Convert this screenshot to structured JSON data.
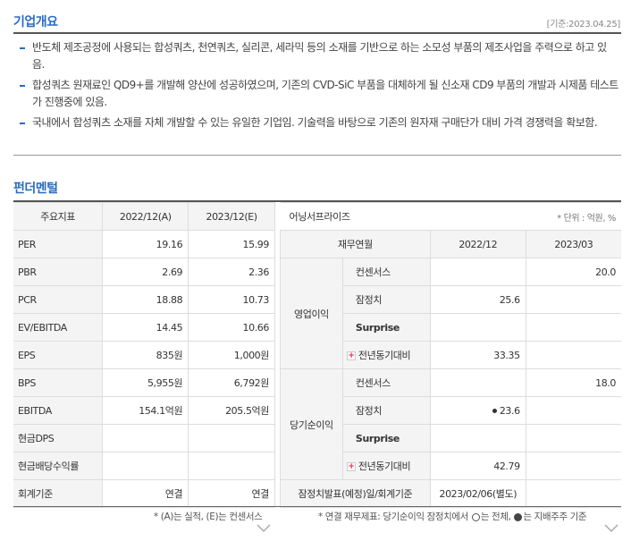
{
  "overview": {
    "title": "기업개요",
    "date": "[기준:2023.04.25]",
    "bullets": [
      "반도체 제조공정에 사용되는 합성쿼츠, 천연쿼츠, 실리콘, 세라믹 등의 소재를 기반으로 하는 소모성 부품의 제조사업을 주력으로 하고 있음.",
      "합성쿼츠 원재료인 QD9+를 개발해 양산에 성공하였으며, 기존의 CVD-SiC 부품을 대체하게 될 신소재 CD9 부품의 개발과 시제품 테스트가 진행중에 있음.",
      "국내에서 합성쿼츠 소재를 자체 개발할 수 있는 유일한 기업임. 기술력을 바탕으로 기존의 원자재 구매단가 대비 가격 경쟁력을 확보함."
    ]
  },
  "fundamental": {
    "title": "펀더멘털",
    "headers": [
      "주요지표",
      "2022/12(A)",
      "2023/12(E)"
    ],
    "rows": [
      {
        "label": "PER",
        "a": "19.16",
        "e": "15.99"
      },
      {
        "label": "PBR",
        "a": "2.69",
        "e": "2.36"
      },
      {
        "label": "PCR",
        "a": "18.88",
        "e": "10.73"
      },
      {
        "label": "EV/EBITDA",
        "a": "14.45",
        "e": "10.66"
      },
      {
        "label": "EPS",
        "a": "835원",
        "e": "1,000원"
      },
      {
        "label": "BPS",
        "a": "5,955원",
        "e": "6,792원"
      },
      {
        "label": "EBITDA",
        "a": "154.1억원",
        "e": "205.5억원"
      },
      {
        "label": "현금DPS",
        "a": "",
        "e": ""
      },
      {
        "label": "현금배당수익률",
        "a": "",
        "e": ""
      },
      {
        "label": "회계기준",
        "a": "연결",
        "e": "연결"
      }
    ],
    "note": "* (A)는 실적, (E)는 컨센서스"
  },
  "surprise": {
    "title": "어닝서프라이즈",
    "unit": "* 단위 : 억원, %",
    "headers": [
      "재무연월",
      "2022/12",
      "2023/03"
    ],
    "groups": [
      {
        "name": "영업이익",
        "rows": [
          {
            "label": "컨센서스",
            "v1": "",
            "v2": "20.0"
          },
          {
            "label": "잠정치",
            "v1": "25.6",
            "v2": ""
          },
          {
            "label": "Surprise",
            "v1": "",
            "v2": ""
          },
          {
            "label": "전년동기대비",
            "v1": "33.35",
            "v2": ""
          }
        ]
      },
      {
        "name": "당기순이익",
        "rows": [
          {
            "label": "컨센서스",
            "v1": "",
            "v2": "18.0"
          },
          {
            "label": "잠정치",
            "v1": "23.6",
            "v2": ""
          },
          {
            "label": "Surprise",
            "v1": "",
            "v2": ""
          },
          {
            "label": "전년동기대비",
            "v1": "42.79",
            "v2": ""
          }
        ]
      }
    ],
    "footer_label": "잠정치발표(예정)일/회계기준",
    "footer_value": "2023/02/06(별도)",
    "note_parts": [
      "* 연결 재무제표: 당기순이익 잠정치에서",
      "는 전체,",
      "는 지배주주 기준"
    ]
  }
}
